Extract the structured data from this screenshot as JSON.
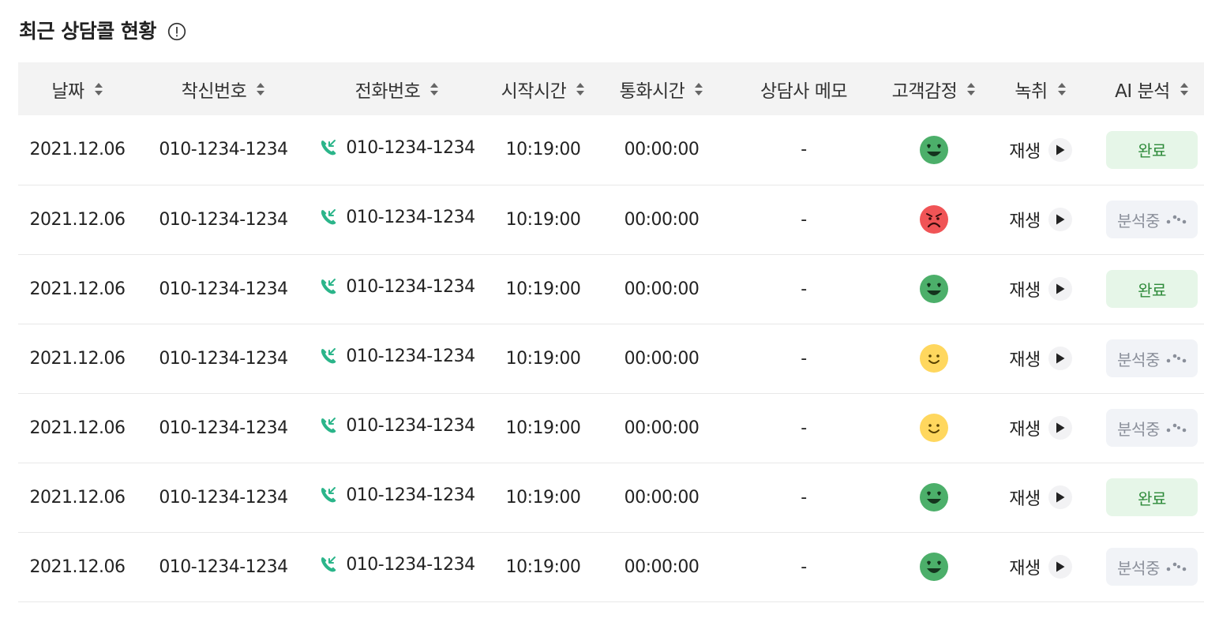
{
  "header": {
    "title": "최근 상담콜 현황",
    "info_icon": "info-circle-icon"
  },
  "table": {
    "columns": [
      "날짜",
      "착신번호",
      "전화번호",
      "시작시간",
      "통화시간",
      "상담사 메모",
      "고객감정",
      "녹취",
      "AI 분석"
    ],
    "sortable": [
      true,
      true,
      true,
      true,
      true,
      false,
      true,
      true,
      true
    ],
    "play_label": "재생",
    "status_labels": {
      "done": "완료",
      "progress": "분석중"
    },
    "colors": {
      "happy": "#4caf6a",
      "angry": "#f05456",
      "neutral": "#ffd75e",
      "phone": "#2bb58a",
      "done_bg": "#e6f6e8",
      "done_text": "#2e8b3a",
      "progress_bg": "#f1f3f7",
      "progress_text": "#8a8f9a"
    },
    "rows": [
      {
        "date": "2021.12.06",
        "callee": "010-1234-1234",
        "phone": "010-1234-1234",
        "start": "10:19:00",
        "duration": "00:00:00",
        "memo": "-",
        "emotion": "happy",
        "status": "done"
      },
      {
        "date": "2021.12.06",
        "callee": "010-1234-1234",
        "phone": "010-1234-1234",
        "start": "10:19:00",
        "duration": "00:00:00",
        "memo": "-",
        "emotion": "angry",
        "status": "progress"
      },
      {
        "date": "2021.12.06",
        "callee": "010-1234-1234",
        "phone": "010-1234-1234",
        "start": "10:19:00",
        "duration": "00:00:00",
        "memo": "-",
        "emotion": "happy",
        "status": "done"
      },
      {
        "date": "2021.12.06",
        "callee": "010-1234-1234",
        "phone": "010-1234-1234",
        "start": "10:19:00",
        "duration": "00:00:00",
        "memo": "-",
        "emotion": "neutral",
        "status": "progress"
      },
      {
        "date": "2021.12.06",
        "callee": "010-1234-1234",
        "phone": "010-1234-1234",
        "start": "10:19:00",
        "duration": "00:00:00",
        "memo": "-",
        "emotion": "neutral",
        "status": "progress"
      },
      {
        "date": "2021.12.06",
        "callee": "010-1234-1234",
        "phone": "010-1234-1234",
        "start": "10:19:00",
        "duration": "00:00:00",
        "memo": "-",
        "emotion": "happy",
        "status": "done"
      },
      {
        "date": "2021.12.06",
        "callee": "010-1234-1234",
        "phone": "010-1234-1234",
        "start": "10:19:00",
        "duration": "00:00:00",
        "memo": "-",
        "emotion": "happy",
        "status": "progress"
      }
    ]
  }
}
